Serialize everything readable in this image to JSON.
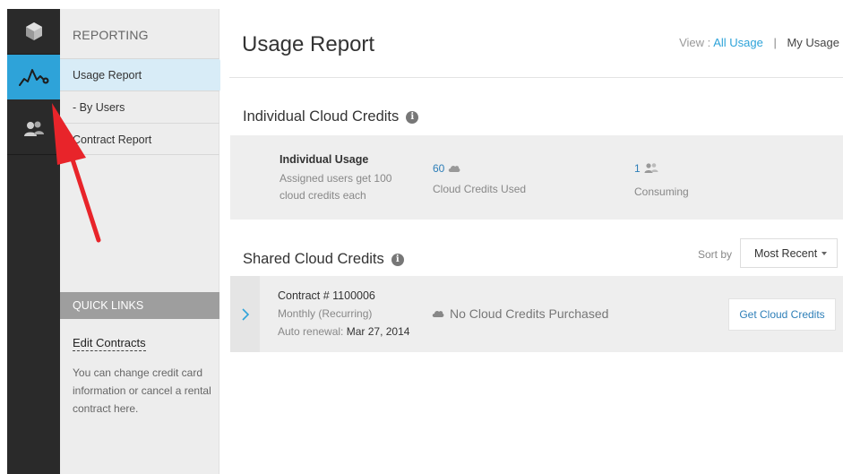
{
  "rail": {
    "items": [
      {
        "icon": "cube-icon"
      },
      {
        "icon": "usage-graph-icon",
        "active": true
      },
      {
        "icon": "users-icon"
      }
    ]
  },
  "nav": {
    "heading": "REPORTING",
    "items": [
      {
        "label": "Usage Report",
        "active": true
      },
      {
        "label": "- By Users"
      },
      {
        "label": "Contract Report"
      }
    ],
    "quick_links": {
      "header": "QUICK LINKS",
      "link": "Edit Contracts",
      "description": "You can change credit card information or cancel a rental contract here."
    }
  },
  "main": {
    "title": "Usage Report",
    "view": {
      "label": "View :",
      "all_usage": "All Usage",
      "separator": "|",
      "my_usage": "My Usage"
    },
    "individual": {
      "section_title": "Individual Cloud Credits",
      "usage_title": "Individual Usage",
      "usage_desc": "Assigned users get 100 cloud credits each",
      "credits_used_value": "60",
      "credits_used_label": "Cloud Credits Used",
      "consuming_value": "1",
      "consuming_label": "Consuming"
    },
    "shared": {
      "section_title": "Shared Cloud Credits",
      "sort_label": "Sort by",
      "sort_value": "Most Recent",
      "contract": {
        "title": "Contract # 1100006",
        "plan": "Monthly (Recurring)",
        "renewal_label": "Auto renewal:",
        "renewal_date": "Mar 27, 2014",
        "status": "No Cloud Credits Purchased",
        "button": "Get Cloud Credits"
      }
    }
  },
  "colors": {
    "accent": "#2ea3d9",
    "link": "#2e7fb8",
    "rail_bg": "#2a2a2a",
    "annotation_arrow": "#e8242a"
  }
}
